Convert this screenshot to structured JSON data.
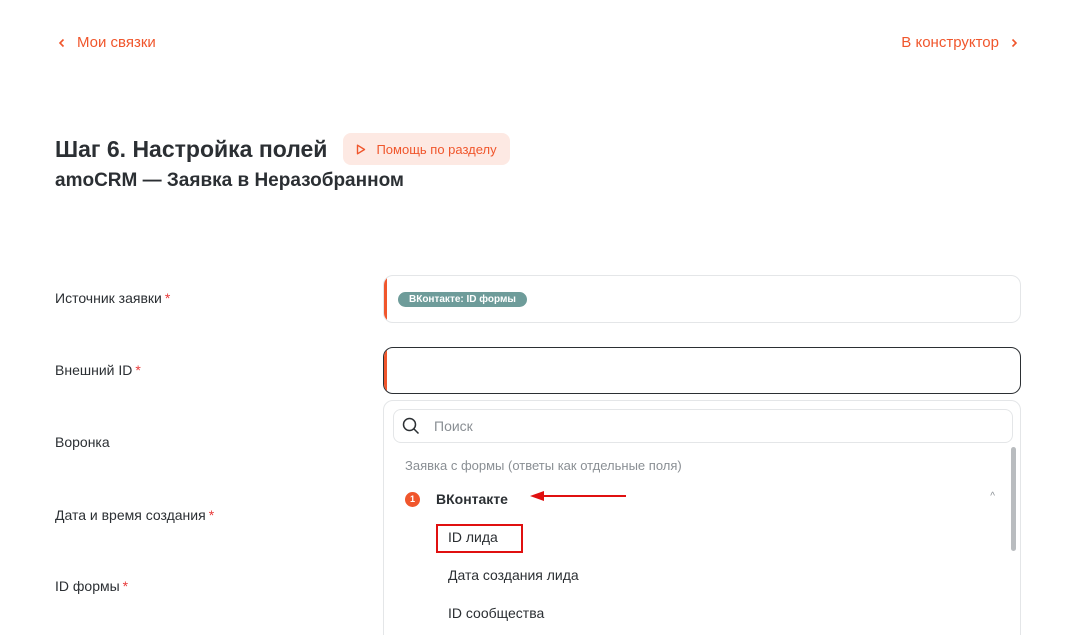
{
  "nav": {
    "back_label": "Мои связки",
    "forward_label": "В конструктор"
  },
  "header": {
    "title": "Шаг 6. Настройка полей",
    "help_label": "Помощь по разделу",
    "subtitle": "amoCRM — Заявка в Неразобранном"
  },
  "fields": [
    {
      "label": "Источник заявки",
      "required": "*"
    },
    {
      "label": "Внешний ID",
      "required": "*"
    },
    {
      "label": "Воронка",
      "required": ""
    },
    {
      "label": "Дата и время создания",
      "required": "*"
    },
    {
      "label": "ID формы",
      "required": "*"
    }
  ],
  "source_tag": "ВКонтакте: ID формы",
  "dropdown": {
    "search_placeholder": "Поиск",
    "group_title": "Заявка с формы (ответы как отдельные поля)",
    "source": {
      "badge": "1",
      "name": "ВКонтакте"
    },
    "options": [
      "ID лида",
      "Дата создания лида",
      "ID сообщества"
    ]
  },
  "colors": {
    "accent": "#f0562c",
    "tag": "#6e9c9a",
    "highlight": "#e01010"
  }
}
